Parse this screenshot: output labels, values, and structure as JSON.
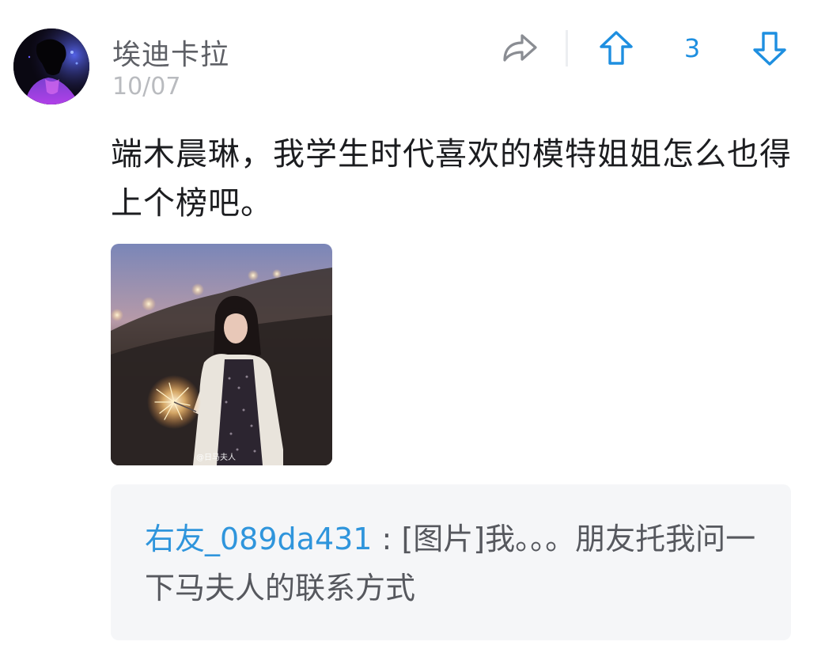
{
  "post": {
    "author": "埃迪卡拉",
    "date": "10/07",
    "text": "端木晨琳，我学生时代喜欢的模特姐姐怎么也得上个榜吧。",
    "image_watermark": "@日马夫人"
  },
  "actions": {
    "share_icon": "share-arrow-icon",
    "upvote_icon": "arrow-up-icon",
    "downvote_icon": "arrow-down-icon",
    "vote_count": "3"
  },
  "comment": {
    "username": "右友_089da431",
    "separator": " : ",
    "text": "[图片]我。。。朋友托我问一下马夫人的联系方式"
  },
  "colors": {
    "accent": "#1e8fe0",
    "username": "#2f95dc",
    "comment_bg": "#f5f6f8",
    "muted_text": "#b9bbbf"
  }
}
